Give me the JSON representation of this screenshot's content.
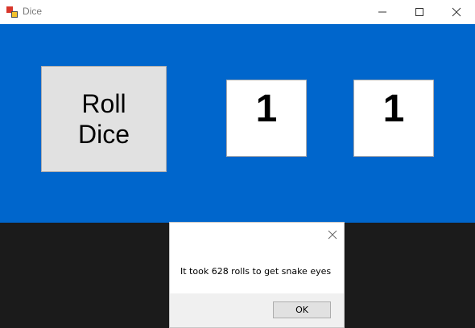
{
  "window": {
    "title": "Dice",
    "app_icon": "dice-app-icon",
    "controls": [
      "minimize-icon",
      "maximize-icon",
      "close-icon"
    ]
  },
  "roll_button": {
    "line1": "Roll",
    "line2": "Dice"
  },
  "dice": {
    "die1": "1",
    "die2": "1"
  },
  "dialog": {
    "message": "It took 628 rolls to get snake eyes",
    "ok_label": "OK",
    "close_icon": "close-icon"
  },
  "colors": {
    "form_background": "#0066cc",
    "titlebar": "#ffffff",
    "button_face": "#e1e1e1",
    "dialog_footer": "#f0f0f0"
  }
}
